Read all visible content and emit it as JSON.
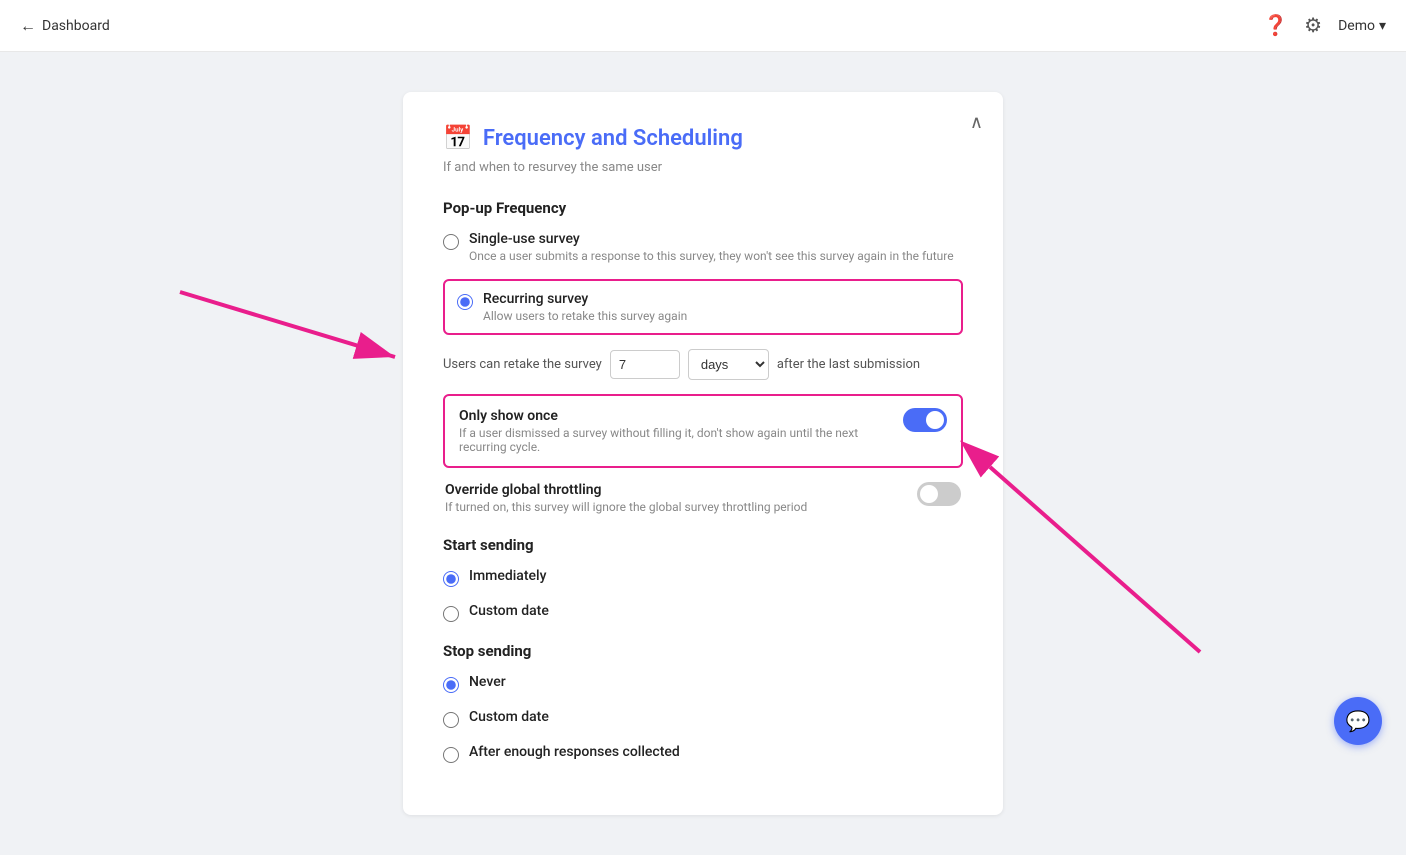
{
  "topbar": {
    "back_label": "Dashboard",
    "help_icon": "❓",
    "settings_icon": "⚙",
    "user_label": "Demo",
    "chevron_icon": "▾"
  },
  "card": {
    "collapse_icon": "∧",
    "section_icon": "📅",
    "section_title": "Frequency and Scheduling",
    "section_subtitle": "If and when to resurvey the same user",
    "popup_frequency_label": "Pop-up Frequency",
    "single_use": {
      "title": "Single-use survey",
      "desc": "Once a user submits a response to this survey, they won't see this survey again in the future"
    },
    "recurring": {
      "title": "Recurring survey",
      "desc": "Allow users to retake this survey again"
    },
    "retake": {
      "prefix": "Users can retake the survey",
      "value": "7",
      "unit": "days",
      "suffix": "after the last submission"
    },
    "only_show_once": {
      "title": "Only show once",
      "desc": "If a user dismissed a survey without filling it, don't show again until the next recurring cycle.",
      "enabled": true
    },
    "override_throttling": {
      "title": "Override global throttling",
      "desc": "If turned on, this survey will ignore the global survey throttling period",
      "enabled": false
    },
    "start_sending_label": "Start sending",
    "start_options": [
      {
        "value": "immediately",
        "label": "Immediately",
        "selected": true
      },
      {
        "value": "custom_date",
        "label": "Custom date",
        "selected": false
      }
    ],
    "stop_sending_label": "Stop sending",
    "stop_options": [
      {
        "value": "never",
        "label": "Never",
        "selected": true
      },
      {
        "value": "custom_date",
        "label": "Custom date",
        "selected": false
      },
      {
        "value": "enough_responses",
        "label": "After enough responses collected",
        "selected": false
      }
    ]
  }
}
